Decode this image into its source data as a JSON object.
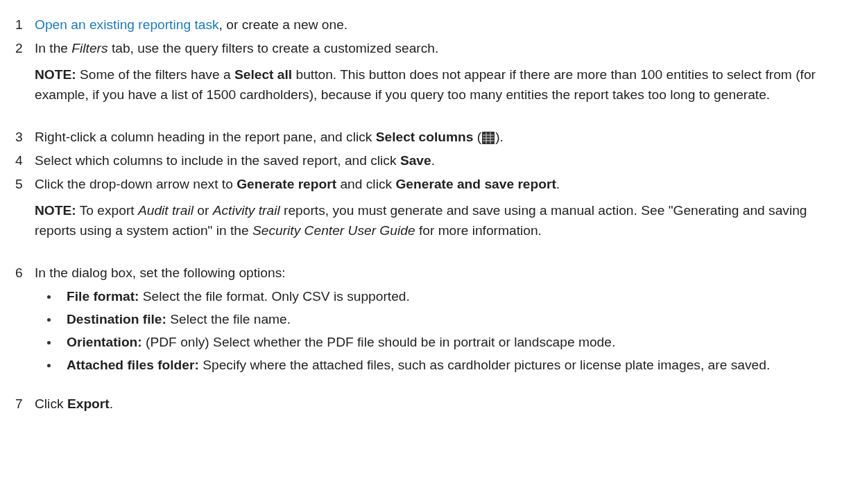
{
  "steps": [
    {
      "number": "1",
      "link": "Open an existing reporting task",
      "parts": [
        ", or create a new one."
      ]
    },
    {
      "number": "2",
      "parts": [
        "In the *Filters* tab, use the query filters to create a customized search."
      ],
      "note": "**NOTE:**  Some of the filters have a **Select all** button. This button does not appear if there are more than 100 entities to select from (for example, if you have a list of 1500 cardholders), because if you query too many entities the report takes too long to generate."
    },
    {
      "number": "3",
      "parts": [
        "Right-click a column heading in the report pane, and click **Select columns** (",
        "). "
      ]
    },
    {
      "number": "4",
      "parts": [
        "Select which columns to include in the saved report, and click **Save**."
      ]
    },
    {
      "number": "5",
      "parts": [
        "Click the drop-down arrow next to **Generate report** and click **Generate and save report**."
      ],
      "note": "**NOTE:**  To export *Audit trail* or *Activity trail* reports, you must generate and save using a manual action. See \"Generating and saving reports using a system action\" in the *Security Center User Guide* for more information."
    },
    {
      "number": "6",
      "parts": [
        "In the dialog box, set the following options:"
      ],
      "bullets": [
        "**File format:** Select the file format. Only CSV is supported.",
        "**Destination file:** Select the file name.",
        "**Orientation:** (PDF only) Select whether the PDF file should be in portrait or landscape mode.",
        "**Attached files folder:** Specify where the attached files, such as cardholder pictures or license plate images, are saved."
      ]
    },
    {
      "number": "7",
      "parts": [
        "Click **Export**."
      ]
    }
  ]
}
